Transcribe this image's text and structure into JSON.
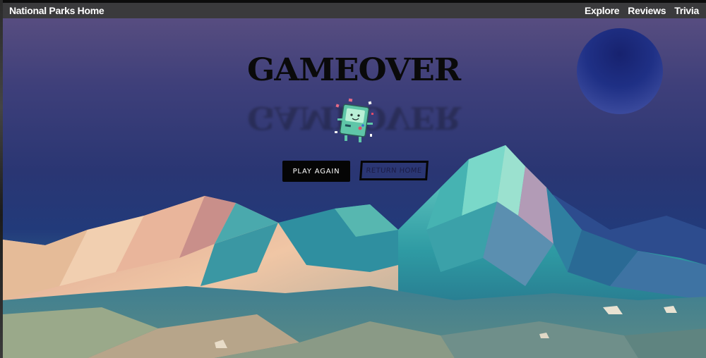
{
  "navbar": {
    "brand": "National Parks Home",
    "links": [
      "Explore",
      "Reviews",
      "Trivia"
    ]
  },
  "game": {
    "title": "GAMEOVER",
    "play_again_label": "PLAY AGAIN",
    "return_home_label": "RETURN HOME"
  },
  "colors": {
    "navbar_bg": "#3a3a3c",
    "sky_top": "#574d80",
    "sky_mid": "#2a3673",
    "moon": "#1d2f86",
    "button_dark": "#050505",
    "mountain_teal": "#2fa3a3",
    "mountain_peach": "#e8b79a"
  },
  "icons": {
    "character": "bmo-robot-icon",
    "moon": "moon-icon"
  }
}
